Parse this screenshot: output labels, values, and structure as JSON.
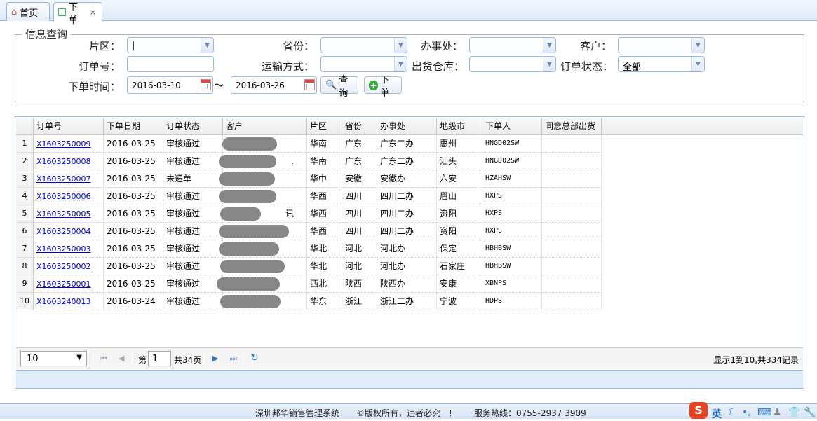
{
  "tabs": [
    {
      "label": "首页",
      "close": ""
    },
    {
      "label": "下单",
      "close": "×"
    }
  ],
  "query": {
    "legend": "信息查询",
    "region_label": "片区：",
    "region_value": "|",
    "province_label": "省份：",
    "province_value": "",
    "office_label": "办事处：",
    "office_value": "",
    "customer_label": "客户：",
    "customer_value": "",
    "order_no_label": "订单号：",
    "order_no_value": "",
    "transport_label": "运输方式：",
    "transport_value": "",
    "warehouse_label": "出货仓库：",
    "warehouse_value": "",
    "status_label": "订单状态：",
    "status_value": "全部",
    "time_label": "下单时间：",
    "date_from": "2016-03-10",
    "tilde": "～",
    "date_to": "2016-03-26",
    "search_button": "查询",
    "order_button": "下单"
  },
  "grid": {
    "columns": [
      "订单号",
      "下单日期",
      "订单状态",
      "客户",
      "片区",
      "省份",
      "办事处",
      "地级市",
      "下单人",
      "同意总部出货"
    ],
    "rows": [
      {
        "n": "1",
        "order": "X1603250009",
        "date": "2016-03-25",
        "status": "审核通过",
        "cust": "",
        "region": "华南",
        "prov": "广东",
        "office": "广东二办",
        "city": "惠州",
        "user": "HNGD02SW",
        "agree": ""
      },
      {
        "n": "2",
        "order": "X1603250008",
        "date": "2016-03-25",
        "status": "审核通过",
        "cust": ".",
        "region": "华南",
        "prov": "广东",
        "office": "广东二办",
        "city": "汕头",
        "user": "HNGD02SW",
        "agree": ""
      },
      {
        "n": "3",
        "order": "X1603250007",
        "date": "2016-03-25",
        "status": "未递单",
        "cust": "",
        "region": "华中",
        "prov": "安徽",
        "office": "安徽办",
        "city": "六安",
        "user": "HZAHSW",
        "agree": ""
      },
      {
        "n": "4",
        "order": "X1603250006",
        "date": "2016-03-25",
        "status": "审核通过",
        "cust": "",
        "region": "华西",
        "prov": "四川",
        "office": "四川二办",
        "city": "眉山",
        "user": "HXPS",
        "agree": ""
      },
      {
        "n": "5",
        "order": "X1603250005",
        "date": "2016-03-25",
        "status": "审核通过",
        "cust": "讯",
        "region": "华西",
        "prov": "四川",
        "office": "四川二办",
        "city": "资阳",
        "user": "HXPS",
        "agree": ""
      },
      {
        "n": "6",
        "order": "X1603250004",
        "date": "2016-03-25",
        "status": "审核通过",
        "cust": "",
        "region": "华西",
        "prov": "四川",
        "office": "四川二办",
        "city": "资阳",
        "user": "HXPS",
        "agree": ""
      },
      {
        "n": "7",
        "order": "X1603250003",
        "date": "2016-03-25",
        "status": "审核通过",
        "cust": "",
        "region": "华北",
        "prov": "河北",
        "office": "河北办",
        "city": "保定",
        "user": "HBHBSW",
        "agree": ""
      },
      {
        "n": "8",
        "order": "X1603250002",
        "date": "2016-03-25",
        "status": "审核通过",
        "cust": "",
        "region": "华北",
        "prov": "河北",
        "office": "河北办",
        "city": "石家庄",
        "user": "HBHBSW",
        "agree": ""
      },
      {
        "n": "9",
        "order": "X1603250001",
        "date": "2016-03-25",
        "status": "审核通过",
        "cust": "",
        "region": "西北",
        "prov": "陕西",
        "office": "陕西办",
        "city": "安康",
        "user": "XBNPS",
        "agree": ""
      },
      {
        "n": "10",
        "order": "X1603240013",
        "date": "2016-03-24",
        "status": "审核通过",
        "cust": "",
        "region": "华东",
        "prov": "浙江",
        "office": "浙江二办",
        "city": "宁波",
        "user": "HDPS",
        "agree": ""
      }
    ]
  },
  "pager": {
    "page_size": "10",
    "page_prefix": "第",
    "page_value": "1",
    "page_suffix": "共34页",
    "summary": "显示1到10,共334记录"
  },
  "footer": {
    "system": "深圳邦华销售管理系统",
    "copyright": "©版权所有，违者必究　!",
    "hotline": "服务热线：0755-2937 3909"
  },
  "tray": {
    "ime_label": "英"
  }
}
